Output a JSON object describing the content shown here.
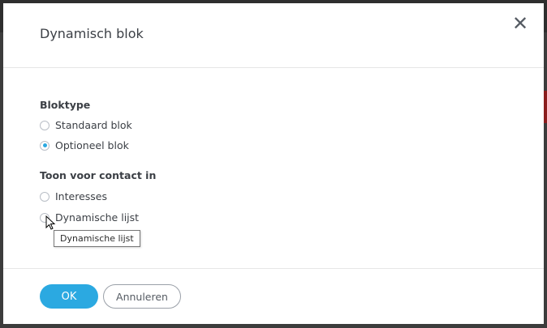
{
  "modal": {
    "title": "Dynamisch blok",
    "close_icon": "close-icon"
  },
  "block_type": {
    "label": "Bloktype",
    "options": [
      {
        "label": "Standaard blok",
        "selected": false
      },
      {
        "label": "Optioneel blok",
        "selected": true
      }
    ]
  },
  "show_for_contact": {
    "label": "Toon voor contact in",
    "options": [
      {
        "label": "Interesses",
        "selected": false
      },
      {
        "label": "Dynamische lijst",
        "selected": false
      }
    ]
  },
  "tooltip": {
    "text": "Dynamische lijst"
  },
  "footer": {
    "ok_label": "OK",
    "cancel_label": "Annuleren"
  },
  "colors": {
    "accent": "#2ba9e1",
    "text": "#3b3f45",
    "border": "#e6e6e6"
  }
}
